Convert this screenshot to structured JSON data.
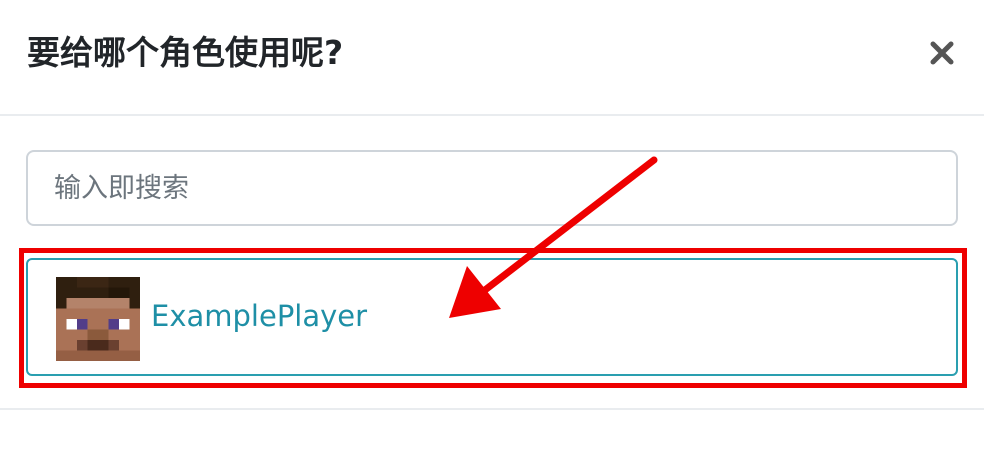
{
  "modal": {
    "title": "要给哪个角色使用呢?",
    "close_label": "×"
  },
  "search": {
    "placeholder": "输入即搜索",
    "value": ""
  },
  "players": [
    {
      "name": "ExamplePlayer",
      "avatar": "steve-head-avatar"
    }
  ],
  "icons": {
    "close": "close-icon",
    "arrow": "annotation-arrow-icon"
  },
  "colors": {
    "title": "#212529",
    "player_name": "#1e8fa6",
    "item_border": "#2a9fb0",
    "highlight": "#ee0000",
    "input_border": "#ced4da",
    "divider": "#e9ecef"
  }
}
